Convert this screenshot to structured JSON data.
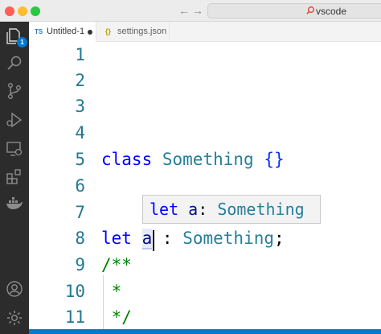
{
  "titlebar": {
    "back_icon": "←",
    "forward_icon": "→",
    "command_center_text": "vscode"
  },
  "activity_bar": {
    "items": [
      {
        "icon": "files-icon",
        "badge": "1"
      },
      {
        "icon": "search-icon"
      },
      {
        "icon": "source-control-icon"
      },
      {
        "icon": "run-debug-icon"
      },
      {
        "icon": "remote-explorer-icon"
      },
      {
        "icon": "extensions-icon"
      },
      {
        "icon": "docker-icon"
      },
      {
        "icon": "accounts-icon"
      },
      {
        "icon": "settings-gear-icon"
      }
    ]
  },
  "tabs": [
    {
      "lang": "TS",
      "label": "Untitled-1",
      "dirty": true,
      "active": true
    },
    {
      "lang": "{}",
      "label": "settings.json",
      "active": false
    }
  ],
  "editor": {
    "line_numbers": [
      "1",
      "2",
      "3",
      "4",
      "5",
      "6",
      "7",
      "8",
      "9",
      "10",
      "11"
    ],
    "line5": {
      "kw": "class",
      "name": "Something",
      "braces": "{}"
    },
    "line8": {
      "kw": "let",
      "var": "a",
      "colon": ":",
      "type": "Something",
      "semi": ";"
    },
    "line9": {
      "comment": "/**"
    },
    "line10": {
      "comment": "*"
    },
    "line11": {
      "comment": "*/"
    },
    "hover": {
      "kw": "let",
      "var": "a",
      "colon": ":",
      "type": "Something"
    }
  },
  "colors": {
    "accent": "#007acc",
    "keyword": "#0000ff",
    "type": "#267f99",
    "comment": "#008000",
    "line_number": "#237893"
  }
}
